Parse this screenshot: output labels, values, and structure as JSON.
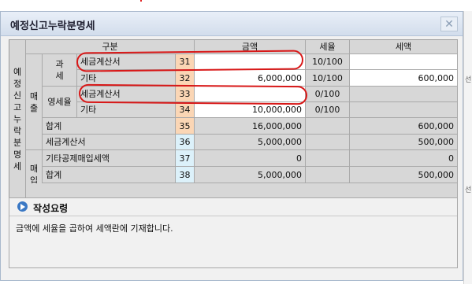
{
  "dialog": {
    "title": "예정신고누락분명세",
    "close_label": "✕"
  },
  "table": {
    "section_label": "예정신고누락분명세",
    "header": {
      "category": "구분",
      "amount": "금액",
      "tax_rate": "세율",
      "tax_amount": "세액"
    },
    "groups": {
      "sales": "매출",
      "taxable": "과세",
      "zero_rated": "영세율",
      "purchase": "매입"
    },
    "rows": [
      {
        "label": "세금계산서",
        "code": "31",
        "amount": "",
        "rate": "10/100",
        "tax": ""
      },
      {
        "label": "기타",
        "code": "32",
        "amount": "6,000,000",
        "rate": "10/100",
        "tax": "600,000"
      },
      {
        "label": "세금계산서",
        "code": "33",
        "amount": "",
        "rate": "0/100",
        "tax": ""
      },
      {
        "label": "기타",
        "code": "34",
        "amount": "10,000,000",
        "rate": "0/100",
        "tax": ""
      },
      {
        "label": "합계",
        "code": "35",
        "amount": "16,000,000",
        "rate": "",
        "tax": "600,000"
      },
      {
        "label": "세금계산서",
        "code": "36",
        "amount": "5,000,000",
        "rate": "",
        "tax": "500,000"
      },
      {
        "label": "기타공제매입세액",
        "code": "37",
        "amount": "0",
        "rate": "",
        "tax": "0"
      },
      {
        "label": "합계",
        "code": "38",
        "amount": "5,000,000",
        "rate": "",
        "tax": "500,000"
      }
    ]
  },
  "guide": {
    "title": "작성요령",
    "text": "금액에 세율을 곱하여 세액란에 기재합니다."
  },
  "edge": {
    "chars": [
      "선",
      "선"
    ]
  },
  "colors": {
    "highlight_oval": "#d81818",
    "code_cell_sales": "#fbd6b5",
    "code_cell_purchase": "#dcf1fa",
    "header_gray": "#d7d7d7"
  }
}
